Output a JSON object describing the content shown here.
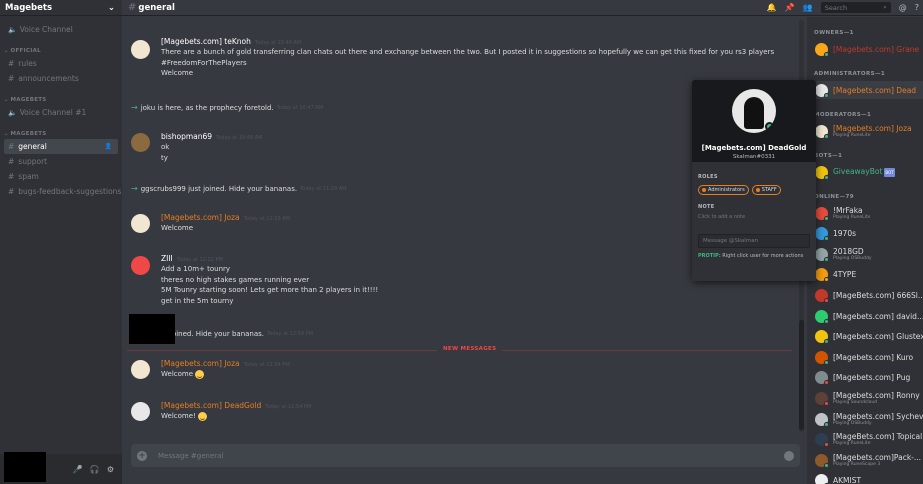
{
  "server": {
    "name": "Magebets"
  },
  "channels": {
    "voice_top": "Voice Channel",
    "cat_official": "OFFICIAL",
    "official": [
      "rules",
      "announcements"
    ],
    "cat_magebets_voice": "MAGEBETS",
    "voice_channel_1": "Voice Channel #1",
    "cat_magebets_text": "MAGEBETS",
    "text": [
      "general",
      "support",
      "spam",
      "bugs-feedback-suggestions"
    ]
  },
  "topbar": {
    "channel": "general",
    "search_placeholder": "Search",
    "help": "?",
    "mention": "@"
  },
  "messages": [
    {
      "user": "[Magebets.com] teKnoh",
      "time": "Today at 10:40 AM",
      "lines": [
        "There are a bunch of gold transferring clan chats out there and exchange between the two. But I posted it in suggestions so hopefully we can get this fixed for you rs3 players",
        "#FreedomForThePlayers",
        "Welcome"
      ]
    },
    {
      "join": "joku is here, as the prophecy foretold.",
      "time": "Today at 10:47 AM"
    },
    {
      "user": "bishopman69",
      "time": "Today at 10:48 AM",
      "lines": [
        "ok",
        "ty"
      ]
    },
    {
      "join": "ggscrubs999 just joined. Hide your bananas.",
      "time": "Today at 11:29 AM"
    },
    {
      "user": "[Magebets.com] Joza",
      "time": "Today at 11:29 AM",
      "lines": [
        "Welcome"
      ]
    },
    {
      "user": "ZIII",
      "time": "Today at 12:22 PM",
      "lines": [
        "Add a 10m+ tounry",
        "theres no high stakes games running ever",
        "5M Tounry starting soon! Lets get more than 2 players in it!!!!",
        "get in the 5m tourny"
      ]
    },
    {
      "join": "joined. Hide your bananas.",
      "time": "Today at 12:54 PM"
    },
    {
      "user": "[Magebets.com] Joza",
      "time": "Today at 12:54 PM",
      "lines": [
        "Welcome"
      ]
    },
    {
      "user": "[Magebets.com] DeadGold",
      "time": "Today at 12:54 PM",
      "lines": [
        "Welcome!"
      ]
    }
  ],
  "new_messages_label": "NEW MESSAGES",
  "composer_placeholder": "Message #general",
  "members": {
    "owners_header": "OWNERS—1",
    "owner": "[Magebets.com] Grane",
    "admins_header": "ADMINISTRATORS—1",
    "admin": "[Magebets.com] Dead",
    "mods_header": "MODERATORS—1",
    "mod": "[Magebets.com] Joza",
    "mod_activity": "Playing RuneLite",
    "bots_header": "BOTS—1",
    "bot": "GiveawayBot",
    "bot_tag": "BOT",
    "online_header": "ONLINE—79",
    "online": [
      {
        "name": "!MrFaka",
        "activity": "Playing RuneLite"
      },
      {
        "name": "1970s",
        "activity": ""
      },
      {
        "name": "2018GD",
        "activity": "Playing OSBuddy"
      },
      {
        "name": "4TYPE",
        "activity": ""
      },
      {
        "name": "[MageBets.com] 666Sl...",
        "activity": ""
      },
      {
        "name": "[Magebets.com] david...",
        "activity": ""
      },
      {
        "name": "[Magebets.com] Glustex",
        "activity": ""
      },
      {
        "name": "[Magebets.com] Kuro",
        "activity": ""
      },
      {
        "name": "[Magebets.com] Pug",
        "activity": ""
      },
      {
        "name": "[Magebets.com] Ronny",
        "activity": "Playing Soundcloud"
      },
      {
        "name": "[Magebets.com] Sychev",
        "activity": "Playing OSBuddy"
      },
      {
        "name": "[MageBets.com] Topical",
        "activity": "Playing RuneLite"
      },
      {
        "name": "[Magebets.com]Pack-...",
        "activity": "Playing RuneScape 3"
      },
      {
        "name": "AKMIST",
        "activity": ""
      }
    ]
  },
  "profile": {
    "name": "[Magebets.com] DeadGold",
    "tag": "Skalman#0331",
    "roles_header": "ROLES",
    "roles": [
      "Administrators",
      "STAFF"
    ],
    "note_header": "NOTE",
    "note_placeholder": "Click to add a note",
    "message_placeholder": "Message @Skalman",
    "protip_label": "PROTIP:",
    "protip_text": "Right click user for more actions"
  }
}
